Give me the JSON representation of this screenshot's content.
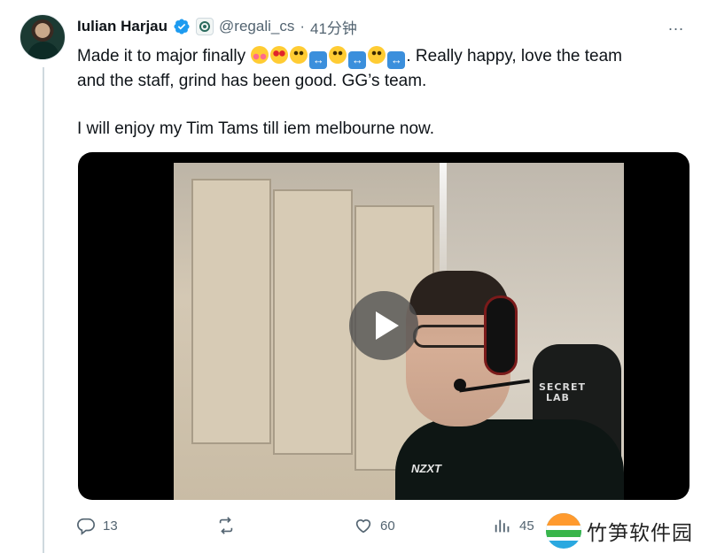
{
  "tweet": {
    "author_name": "Iulian Harjau",
    "handle": "@regali_cs",
    "separator": "·",
    "time": "41分钟",
    "text_line1": "Made it to major finally",
    "text_line1_after_emoji": ". Really happy, love the team",
    "text_line2": "and the staff, grind has been good. GG’s team.",
    "text_line3": "I will enjoy my Tim Tams till iem melbourne now.",
    "emojis": [
      "smiling-face-with-hearts",
      "star-struck",
      "slightly-smiling-face",
      "left-right-arrow",
      "slightly-smiling-face",
      "left-right-arrow",
      "slightly-smiling-face",
      "left-right-arrow"
    ],
    "more_icon": "..."
  },
  "video": {
    "chair_brand_line1": "SECRET",
    "chair_brand_line2": "LAB",
    "shirt_logo": "NZXT",
    "play_icon": "play-icon"
  },
  "actions": {
    "reply_count": "13",
    "retweet_count": "",
    "like_count": "60",
    "views_count": "45"
  },
  "watermark": {
    "site_name": "竹笋软件园"
  },
  "colors": {
    "text": "#0f1419",
    "secondary": "#536471",
    "verified": "#1d9bf0",
    "video_bg": "#000000"
  }
}
